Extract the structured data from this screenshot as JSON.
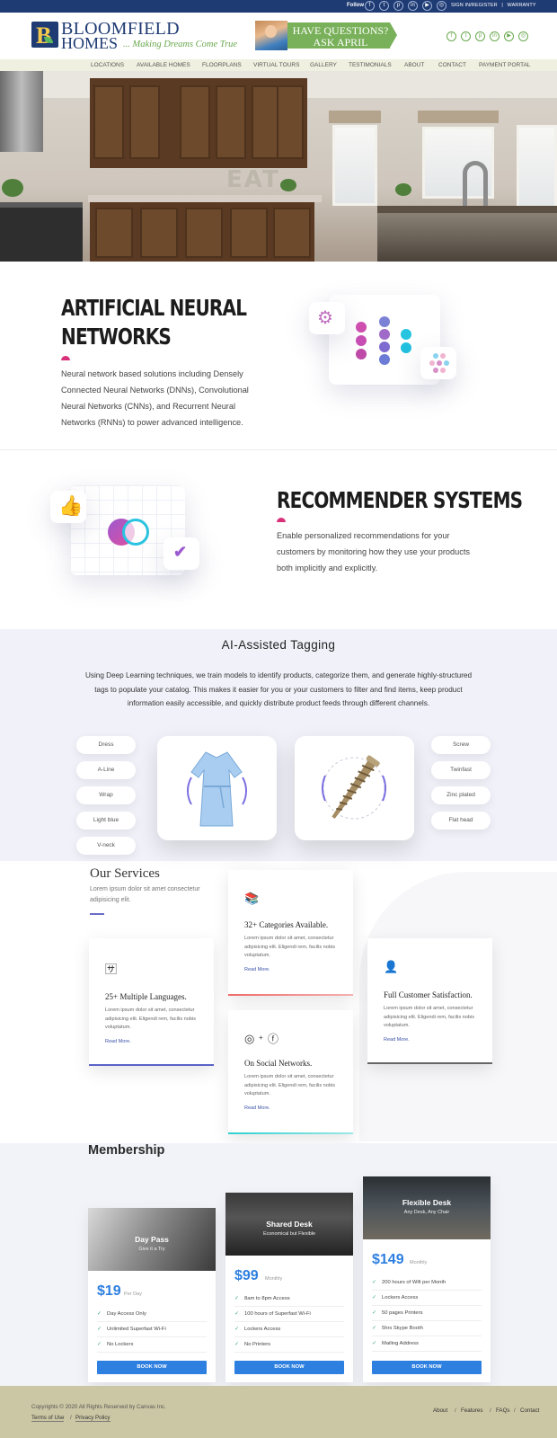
{
  "topbar": {
    "follow_label": "Follow",
    "social_icons": [
      "facebook-icon",
      "twitter-icon",
      "pinterest-icon",
      "linkedin-icon",
      "youtube-icon",
      "instagram-icon"
    ],
    "links": [
      "SIGN IN/REGISTER",
      "|",
      "WARRANTY"
    ]
  },
  "header": {
    "brand_line1": "BLOOMFIELD",
    "brand_line2": "HOMES",
    "tagline": "... Making Dreams Come True",
    "ask_line1": "HAVE QUESTIONS?",
    "ask_line2": "ASK APRIL",
    "social_icons": [
      "facebook-icon",
      "twitter-icon",
      "pinterest-icon",
      "linkedin-icon",
      "youtube-icon",
      "instagram-icon"
    ]
  },
  "nav": {
    "items": [
      "LOCATIONS",
      "AVAILABLE HOMES",
      "FLOORPLANS",
      "VIRTUAL TOURS",
      "GALLERY",
      "TESTIMONIALS",
      "ABOUT",
      "CONTACT",
      "PAYMENT PORTAL"
    ]
  },
  "hero": {
    "overlay_text": "EAT"
  },
  "ann": {
    "title_line1": "ARTIFICIAL NEURAL",
    "title_line2": "NETWORKS",
    "lines": [
      "Neural network based solutions including Densely",
      "Connected Neural Networks (DNNs), Convolutional",
      "Neural Networks (CNNs), and Recurrent Neural",
      "Networks (RNNs) to power advanced intelligence."
    ]
  },
  "recommender": {
    "title": "RECOMMENDER SYSTEMS",
    "lines": [
      "Enable personalized recommendations for your",
      "customers by monitoring how they use your products",
      "both implicitly and explicitly."
    ]
  },
  "tagging": {
    "title": "AI-Assisted Tagging",
    "lines": [
      "Using Deep Learning techniques, we train models to identify products, categorize them, and generate highly-structured",
      "tags to populate your catalog. This makes it easier for you or your customers to filter and find items, keep product",
      "information easily accessible, and quickly distribute product feeds through different channels."
    ],
    "left_tags": [
      "Dress",
      "A-Line",
      "Wrap",
      "Light blue",
      "V-neck"
    ],
    "right_tags": [
      "Screw",
      "Twinfast",
      "Zinc plated",
      "Flat head"
    ]
  },
  "services": {
    "title": "Our Services",
    "subtitle": "Lorem ipsum dolor sit amet consectetur adipisicing elit.",
    "cards": [
      {
        "title": "25+ Multiple Languages.",
        "body": "Lorem ipsum dolor sit amet, consectetur adipisicing elit. Eligendi rem, facilis nobis voluptatum.",
        "more": "Read More.",
        "icon": "translate-icon"
      },
      {
        "title": "32+ Categories Available.",
        "body": "Lorem ipsum dolor sit amet, consectetur adipisicing elit. Eligendi rem, facilis nobis voluptatum.",
        "more": "Read More.",
        "icon": "library-icon"
      },
      {
        "title": "On Social Networks.",
        "body": "Lorem ipsum dolor sit amet, consectetur adipisicing elit. Eligendi rem, facilis nobis voluptatum.",
        "more": "Read More.",
        "icon": "instagram-icon",
        "plus": "+"
      },
      {
        "title": "Full Customer Satisfaction.",
        "body": "Lorem ipsum dolor sit amet, consectetur adipisicing elit. Eligendi rem, facilis nobis voluptatum.",
        "more": "Read More.",
        "icon": "support-agent-icon"
      }
    ]
  },
  "membership": {
    "title": "Membership",
    "plans": [
      {
        "name": "Day Pass",
        "sub": "Give it a Try",
        "price": "$19",
        "per": "Per Day",
        "features": [
          "Day Access Only",
          "Unlimited Superfast Wi-Fi",
          "No Lockers"
        ],
        "button": "BOOK NOW"
      },
      {
        "name": "Shared Desk",
        "sub": "Economical but Flexible",
        "price": "$99",
        "per": "Monthly",
        "features": [
          "8am to 8pm Access",
          "100 hours of Superfast Wi-Fi",
          "Lockers Access",
          "No Printers"
        ],
        "button": "BOOK NOW"
      },
      {
        "name": "Flexible Desk",
        "sub": "Any Desk, Any Chair",
        "price": "$149",
        "per": "Monthly",
        "features": [
          "200 hours of Wifi per Month",
          "Lockers Access",
          "50 pages Printers",
          "5hrs Skype Booth",
          "Mailing Address"
        ],
        "button": "BOOK NOW"
      }
    ]
  },
  "footer": {
    "copyright": "Copyrights © 2020 All Rights Reserved by Canvas Inc.",
    "legal_links": [
      "Terms of Use",
      "Privacy Policy"
    ],
    "legal_sep": "/",
    "right_links": [
      "About",
      "Features",
      "FAQs",
      "Contact"
    ],
    "right_sep": "/"
  },
  "colors": {
    "brand_navy": "#1f3b73",
    "brand_green": "#6aa84f",
    "accent_pink": "#d9307a",
    "button_blue": "#2d7fe0",
    "footer_bg": "#cbc7a4"
  }
}
